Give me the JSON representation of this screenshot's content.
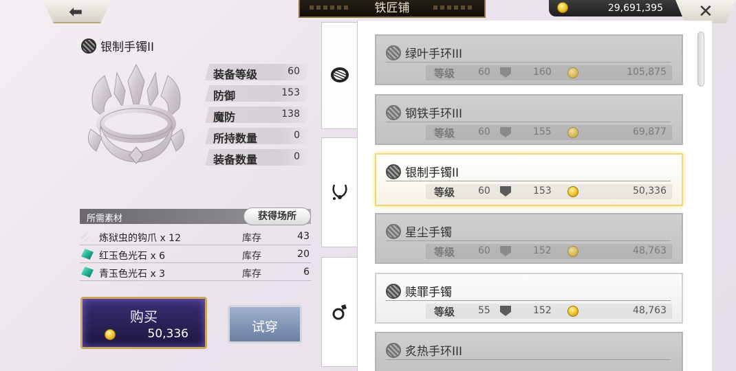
{
  "header": {
    "title": "铁匠铺",
    "gold": "29,691,395"
  },
  "item": {
    "name": "银制手镯II",
    "stats": [
      {
        "label": "装备等级",
        "value": "60"
      },
      {
        "label": "防御",
        "value": "153"
      },
      {
        "label": "魔防",
        "value": "138"
      },
      {
        "label": "所持数量",
        "value": "0"
      },
      {
        "label": "装备数量",
        "value": "0"
      }
    ]
  },
  "materials": {
    "header": "所需素材",
    "acquire_label": "获得场所",
    "rows": [
      {
        "name": "炼狱虫的钩爪 x 12",
        "stock_label": "库存",
        "stock": "43",
        "icon": "claw-icon"
      },
      {
        "name": "红玉色光石 x 6",
        "stock_label": "库存",
        "stock": "20",
        "icon": "gem-icon"
      },
      {
        "name": "青玉色光石 x 3",
        "stock_label": "库存",
        "stock": "6",
        "icon": "gem-icon"
      }
    ]
  },
  "buy": {
    "label": "购买",
    "price": "50,336"
  },
  "try_on": {
    "label": "试穿"
  },
  "list": {
    "items": [
      {
        "name": "绿叶手环III",
        "level_label": "等级",
        "level": "60",
        "defense": "160",
        "price": "105,875",
        "state": "dim"
      },
      {
        "name": "钢铁手环III",
        "level_label": "等级",
        "level": "60",
        "defense": "155",
        "price": "69,877",
        "state": "dim"
      },
      {
        "name": "银制手镯II",
        "level_label": "等级",
        "level": "60",
        "defense": "153",
        "price": "50,336",
        "state": "selected"
      },
      {
        "name": "星尘手镯",
        "level_label": "等级",
        "level": "60",
        "defense": "152",
        "price": "48,763",
        "state": "dim"
      },
      {
        "name": "赎罪手镯",
        "level_label": "等级",
        "level": "55",
        "defense": "152",
        "price": "48,763",
        "state": "bright"
      },
      {
        "name": "炙热手环III",
        "level_label": "",
        "level": "",
        "defense": "",
        "price": "",
        "state": "dim"
      }
    ]
  },
  "colors": {
    "selected_border": "#f1d774",
    "buy_bg": "#2a2058",
    "gold_frame": "#c9a85c"
  }
}
